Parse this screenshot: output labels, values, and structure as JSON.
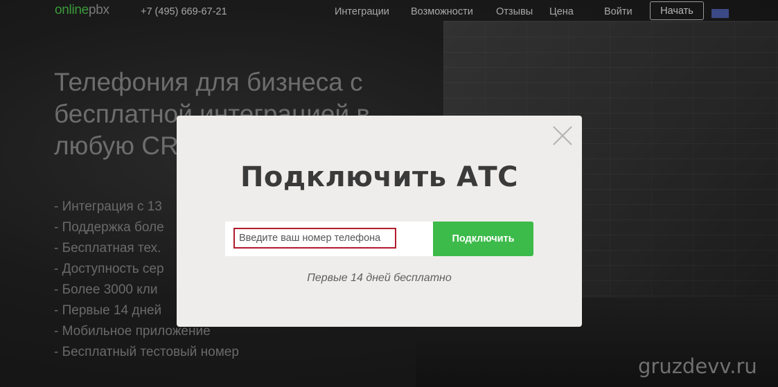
{
  "header": {
    "logo": {
      "part1": "online",
      "part2": "pbx"
    },
    "phone": "+7 (495) 669-67-21",
    "nav": [
      "Интеграции",
      "Возможности",
      "Отзывы",
      "Цена"
    ],
    "login": "Войти",
    "start": "Начать"
  },
  "hero": {
    "title_lines": [
      "Телефония для бизнеса с",
      "бесплатной интеграцией в",
      "любую CR"
    ],
    "features": [
      "- Интеграция с 13",
      "- Поддержка боле",
      "- Бесплатная тех.",
      "- Доступность сер",
      "- Более 3000 кли",
      "- Первые 14 дней",
      "- Мобильное приложение",
      "- Бесплатный тестовый номер"
    ]
  },
  "modal": {
    "title": "Подключить АТС",
    "input_placeholder": "Введите ваш номер телефона",
    "button": "Подключить",
    "note": "Первые 14 дней бесплатно"
  },
  "watermark": "gruzdevv.ru",
  "colors": {
    "accent_green": "#3dbb4a",
    "logo_green": "#3a9a3a",
    "input_border_red": "#b11a2b",
    "modal_bg": "#efedeb"
  }
}
